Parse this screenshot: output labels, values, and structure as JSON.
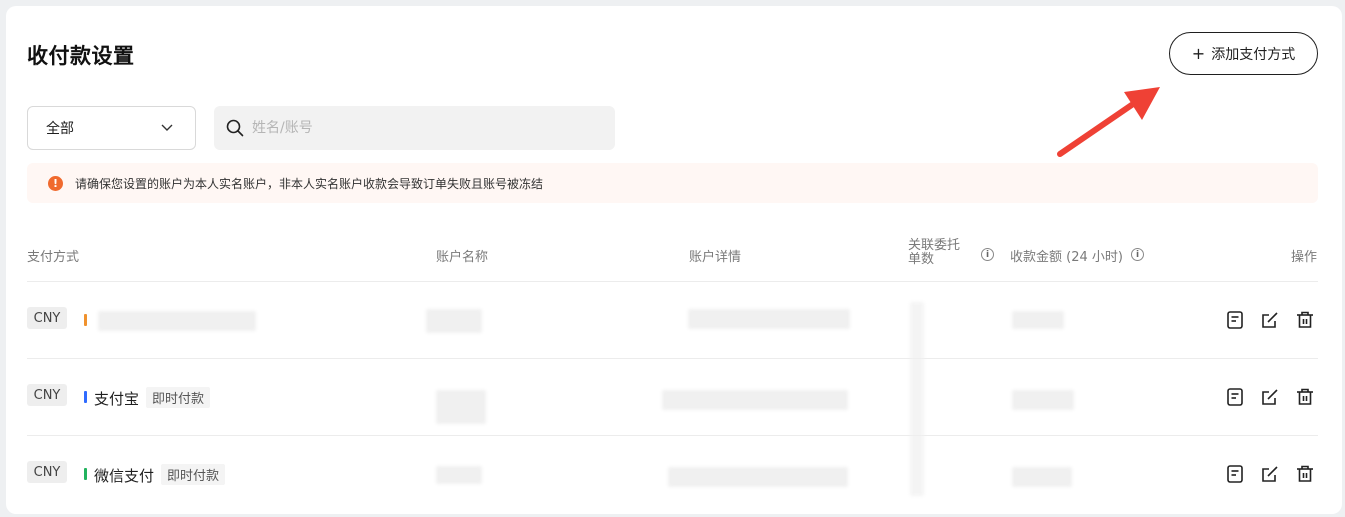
{
  "header": {
    "title": "收付款设置",
    "add_button_label": "添加支付方式",
    "add_icon": "plus-icon"
  },
  "filters": {
    "select_value": "全部",
    "search_placeholder": "姓名/账号"
  },
  "notice": {
    "icon": "exclamation-icon",
    "text": "请确保您设置的账户为本人实名账户，非本人实名账户收款会导致订单失败且账号被冻结"
  },
  "table": {
    "columns": {
      "method": "支付方式",
      "account_name": "账户名称",
      "account_detail": "账户详情",
      "linked_orders_line1": "关联委托",
      "linked_orders_line2": "单数",
      "amount_24h": "收款金额 (24 小时)",
      "actions": "操作"
    },
    "rows": [
      {
        "currency": "CNY",
        "method_color": "#f0922e",
        "method": "",
        "tag": ""
      },
      {
        "currency": "CNY",
        "method_color": "#2f6bff",
        "method": "支付宝",
        "tag": "即时付款"
      },
      {
        "currency": "CNY",
        "method_color": "#22b35e",
        "method": "微信支付",
        "tag": "即时付款"
      }
    ]
  },
  "colors": {
    "accent_orange": "#f06a2e",
    "arrow_red": "#ef4135"
  }
}
